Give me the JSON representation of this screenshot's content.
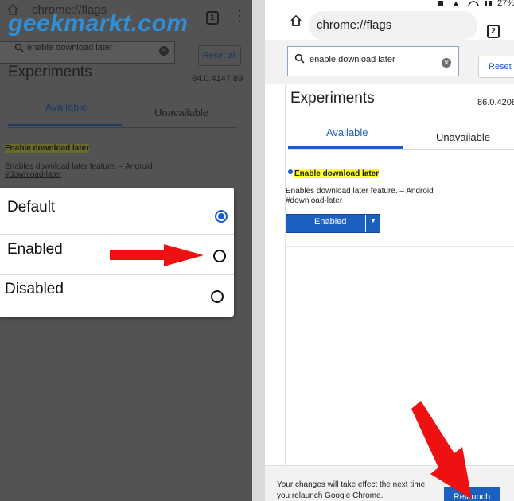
{
  "watermark": "geekmarkt.com",
  "left": {
    "url": "chrome://flags",
    "tab_count": "1",
    "search_value": "enable download later",
    "reset_label": "Reset all",
    "title": "Experiments",
    "version": "84.0.4147.89",
    "tabs": [
      {
        "label": "Available"
      },
      {
        "label": "Unavailable"
      }
    ],
    "flag": {
      "name": "Enable download later",
      "description": "Enables download later feature. – Android",
      "link": "#download-later"
    },
    "dialog": {
      "options": [
        {
          "label": "Default",
          "selected": true
        },
        {
          "label": "Enabled",
          "selected": false
        },
        {
          "label": "Disabled",
          "selected": false
        }
      ]
    }
  },
  "right": {
    "status_battery": "27%",
    "url": "chrome://flags",
    "tab_count": "2",
    "search_value": "enable download later",
    "reset_label": "Reset a",
    "title": "Experiments",
    "version": "86.0.4208",
    "tabs": [
      {
        "label": "Available"
      },
      {
        "label": "Unavailable"
      }
    ],
    "flag": {
      "name": "Enable download later",
      "description": "Enables download later feature. – Android",
      "link": "#download-later",
      "select_value": "Enabled"
    },
    "footer": {
      "line1": "Your changes will take effect the next time",
      "line2": "you relaunch Google Chrome.",
      "relaunch_label": "Relaunch"
    }
  },
  "colors": {
    "accent_blue": "#1b5fbf",
    "radio_selected": "#1a5ad7",
    "arrow_red": "#ee1111",
    "highlight_yellow": "#ffff33",
    "overlay_gray": "#535353"
  }
}
